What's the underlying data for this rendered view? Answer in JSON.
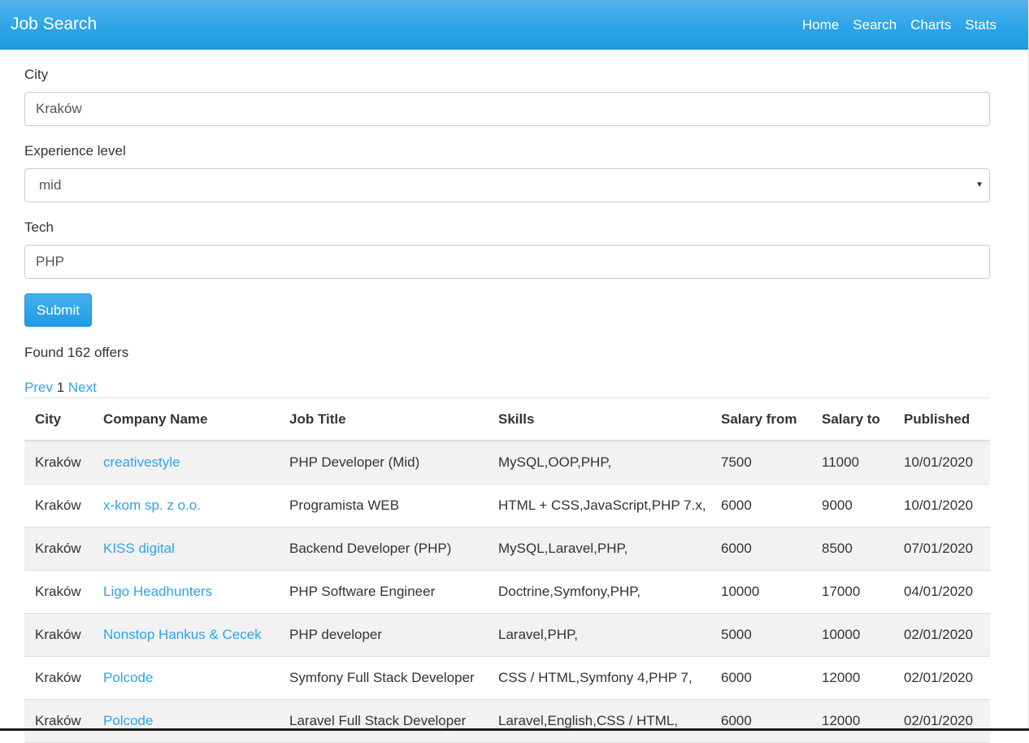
{
  "navbar": {
    "brand": "Job Search",
    "links": [
      "Home",
      "Search",
      "Charts",
      "Stats"
    ]
  },
  "form": {
    "city_label": "City",
    "city_value": "Kraków",
    "experience_label": "Experience level",
    "experience_value": "mid",
    "tech_label": "Tech",
    "tech_value": "PHP",
    "submit_label": "Submit"
  },
  "results": {
    "found_text": "Found 162 offers",
    "pager": {
      "prev": "Prev",
      "current": "1",
      "next": "Next"
    }
  },
  "table": {
    "headers": [
      "City",
      "Company Name",
      "Job Title",
      "Skills",
      "Salary from",
      "Salary to",
      "Published"
    ],
    "rows": [
      [
        "Kraków",
        "creativestyle",
        "PHP Developer (Mid)",
        "MySQL,OOP,PHP,",
        "7500",
        "11000",
        "10/01/2020"
      ],
      [
        "Kraków",
        "x-kom sp. z o.o.",
        "Programista WEB",
        "HTML + CSS,JavaScript,PHP 7.x,",
        "6000",
        "9000",
        "10/01/2020"
      ],
      [
        "Kraków",
        "KISS digital",
        "Backend Developer (PHP)",
        "MySQL,Laravel,PHP,",
        "6000",
        "8500",
        "07/01/2020"
      ],
      [
        "Kraków",
        "Ligo Headhunters",
        "PHP Software Engineer",
        "Doctrine,Symfony,PHP,",
        "10000",
        "17000",
        "04/01/2020"
      ],
      [
        "Kraków",
        "Nonstop Hankus & Cecek",
        "PHP developer",
        "Laravel,PHP,",
        "5000",
        "10000",
        "02/01/2020"
      ],
      [
        "Kraków",
        "Polcode",
        "Symfony Full Stack Developer",
        "CSS / HTML,Symfony 4,PHP 7,",
        "6000",
        "12000",
        "02/01/2020"
      ],
      [
        "Kraków",
        "Polcode",
        "Laravel Full Stack Developer",
        "Laravel,English,CSS / HTML,",
        "6000",
        "12000",
        "02/01/2020"
      ]
    ]
  },
  "colors": {
    "accent": "#2fa4e7",
    "stripe": "#f2f2f2"
  }
}
